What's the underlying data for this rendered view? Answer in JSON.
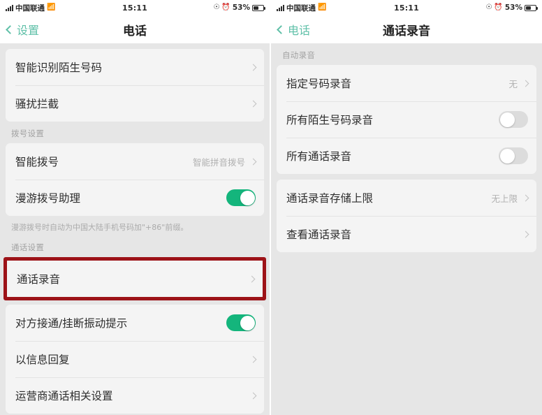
{
  "theme": {
    "accent_green": "#14b57c",
    "nav_link": "#5fc0a8",
    "highlight_red": "#9d1318",
    "page_bg": "#e6e6e6",
    "card_bg": "#f4f4f4"
  },
  "left": {
    "status": {
      "carrier": "中国联通",
      "time": "15:11",
      "battery_percent": "53%",
      "icons": [
        "signal-bars-icon",
        "wifi-icon",
        "vibrate-icon",
        "alarm-clock-icon",
        "battery-icon"
      ]
    },
    "nav": {
      "back_label": "设置",
      "title": "电话"
    },
    "sections": [
      {
        "header": "",
        "rows": [
          {
            "label": "智能识别陌生号码",
            "value": "",
            "accessory": "chevron"
          },
          {
            "label": "骚扰拦截",
            "value": "",
            "accessory": "chevron"
          }
        ]
      },
      {
        "header": "拨号设置",
        "rows": [
          {
            "label": "智能拨号",
            "value": "智能拼音拨号",
            "accessory": "chevron"
          },
          {
            "label": "漫游拨号助理",
            "value": "",
            "accessory": "toggle-on"
          }
        ],
        "note": "漫游拨号时自动为中国大陆手机号码加\"+86\"前缀。"
      },
      {
        "header": "通话设置",
        "highlighted": true,
        "rows": [
          {
            "label": "通话录音",
            "value": "",
            "accessory": "chevron"
          }
        ]
      },
      {
        "header": "",
        "rows": [
          {
            "label": "对方接通/挂断振动提示",
            "value": "",
            "accessory": "toggle-on"
          },
          {
            "label": "以信息回复",
            "value": "",
            "accessory": "chevron"
          },
          {
            "label": "运营商通话相关设置",
            "value": "",
            "accessory": "chevron"
          }
        ]
      }
    ]
  },
  "right": {
    "status": {
      "carrier": "中国联通",
      "time": "15:11",
      "battery_percent": "53%",
      "icons": [
        "signal-bars-icon",
        "wifi-icon",
        "vibrate-icon",
        "alarm-clock-icon",
        "battery-icon"
      ]
    },
    "nav": {
      "back_label": "电话",
      "title": "通话录音"
    },
    "sections": [
      {
        "header": "自动录音",
        "rows": [
          {
            "label": "指定号码录音",
            "value": "无",
            "accessory": "chevron"
          },
          {
            "label": "所有陌生号码录音",
            "value": "",
            "accessory": "toggle-off"
          },
          {
            "label": "所有通话录音",
            "value": "",
            "accessory": "toggle-off"
          }
        ]
      },
      {
        "header": "",
        "rows": [
          {
            "label": "通话录音存储上限",
            "value": "无上限",
            "accessory": "chevron"
          },
          {
            "label": "查看通话录音",
            "value": "",
            "accessory": "chevron"
          }
        ]
      }
    ]
  }
}
